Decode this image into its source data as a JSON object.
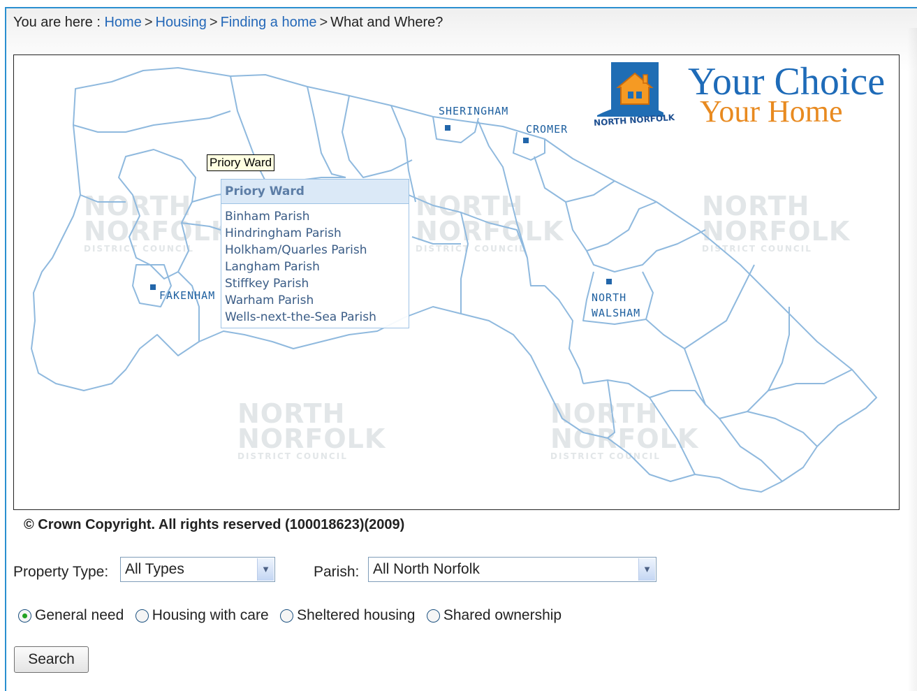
{
  "breadcrumb": {
    "prefix": "You are here :",
    "links": [
      "Home",
      "Housing",
      "Finding a home"
    ],
    "separator": ">",
    "current": "What and Where?"
  },
  "map": {
    "logo": {
      "line1": "Your Choice",
      "line2": "Your Home",
      "district": "NORTH NORFOLK"
    },
    "watermark": {
      "line1": "NORTH",
      "line2": "NORFOLK",
      "line3": "DISTRICT COUNCIL"
    },
    "towns": {
      "sheringham": "SHERINGHAM",
      "cromer": "CROMER",
      "fakenham": "FAKENHAM",
      "north_walsham_1": "NORTH",
      "north_walsham_2": "WALSHAM"
    },
    "tooltip": "Priory Ward",
    "popup": {
      "title": "Priory Ward",
      "parishes": [
        "Binham Parish",
        "Hindringham Parish",
        "Holkham/Quarles Parish",
        "Langham Parish",
        "Stiffkey Parish",
        "Warham Parish",
        "Wells-next-the-Sea Parish"
      ]
    }
  },
  "copyright": "© Crown Copyright. All rights reserved (100018623)(2009)",
  "form": {
    "property_type_label": "Property Type:",
    "property_type_value": "All Types",
    "parish_label": "Parish:",
    "parish_value": "All North Norfolk",
    "radios": [
      {
        "label": "General need",
        "checked": true
      },
      {
        "label": "Housing with care",
        "checked": false
      },
      {
        "label": "Sheltered housing",
        "checked": false
      },
      {
        "label": "Shared ownership",
        "checked": false
      }
    ],
    "search_label": "Search"
  },
  "colors": {
    "link": "#2468b8",
    "map_line": "#8fb9de",
    "town": "#1d5f9f",
    "logo_blue": "#1e6bb8",
    "logo_orange": "#e88a20"
  }
}
